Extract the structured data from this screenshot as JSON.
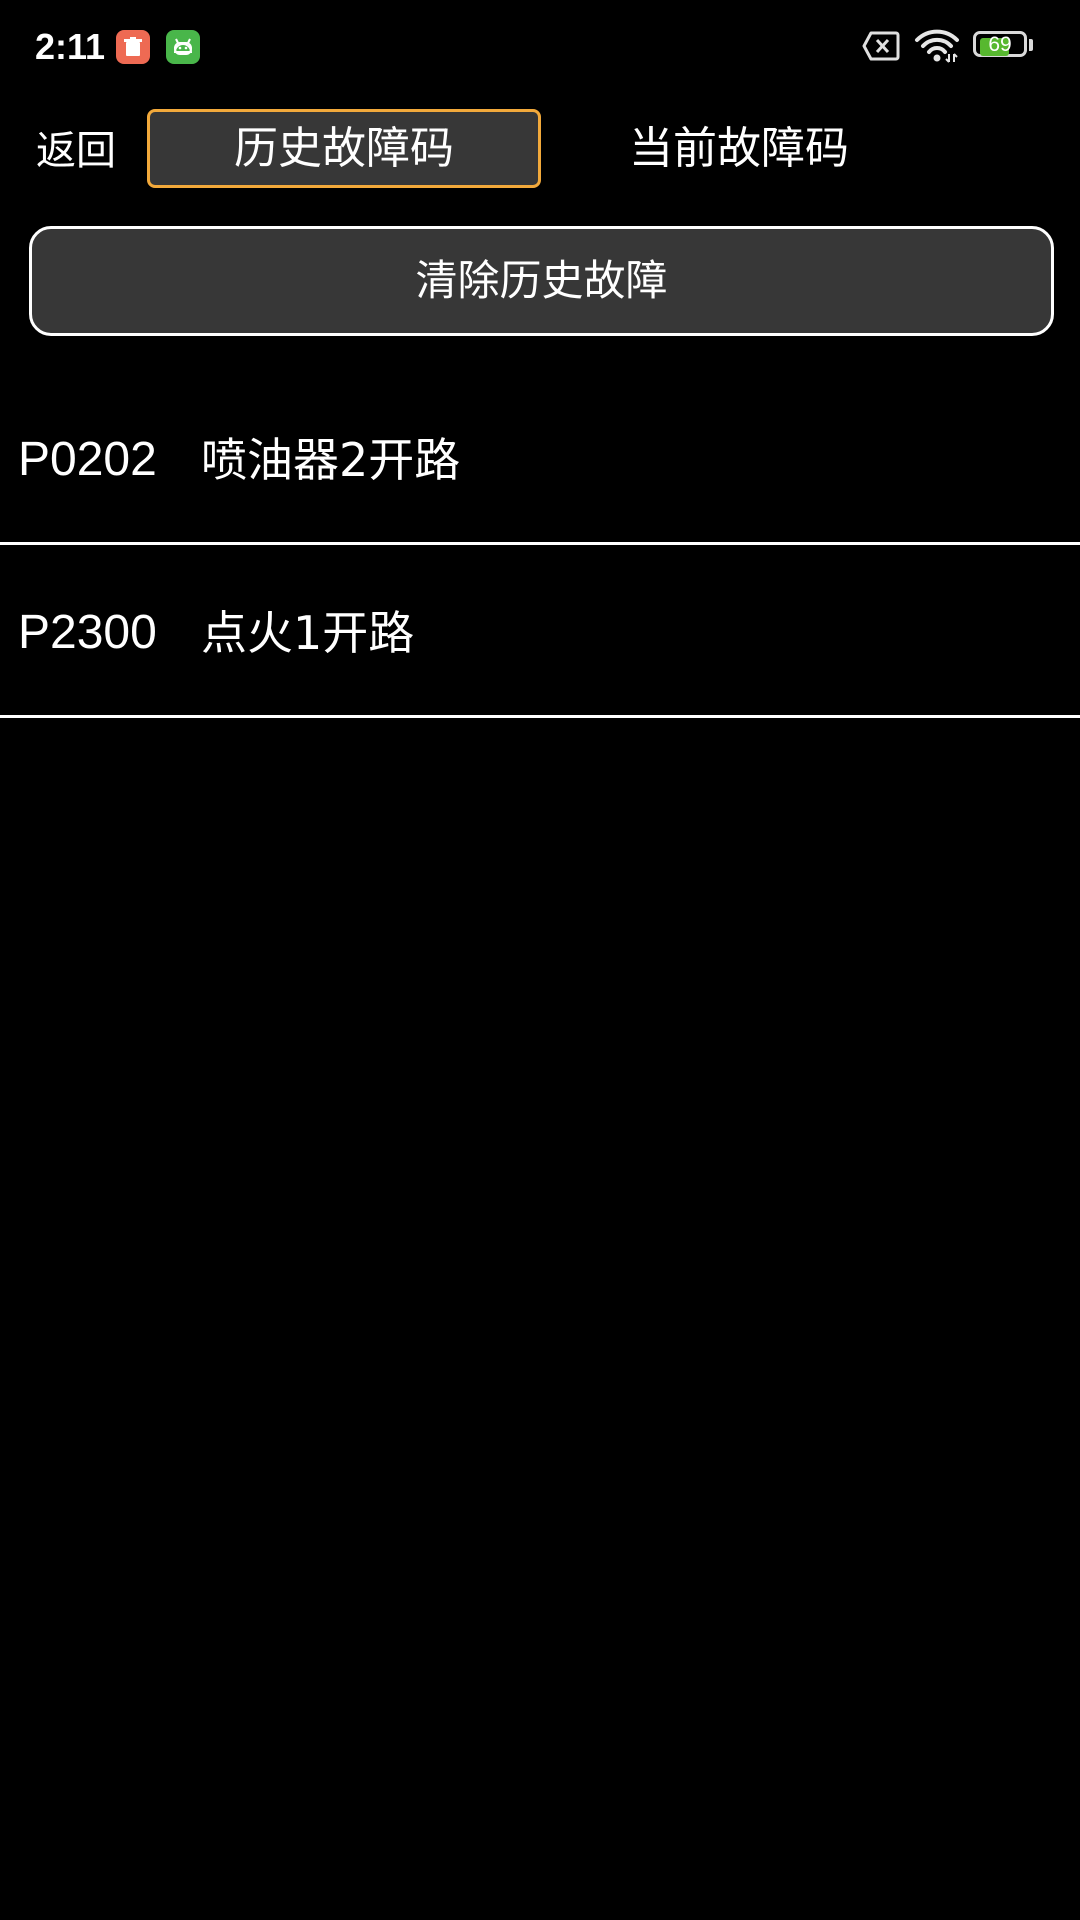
{
  "status_bar": {
    "time": "2:11",
    "battery_level": "69",
    "battery_fraction": 0.69,
    "icons": [
      "trash-app-icon",
      "android-app-icon",
      "no-sim-icon",
      "wifi-icon",
      "battery-icon"
    ],
    "colors": {
      "trash_app": "#ee6a53",
      "android_app": "#49b64a",
      "battery_fill": "#57b82f"
    }
  },
  "nav": {
    "back_label": "返回",
    "tabs": [
      {
        "label": "历史故障码",
        "selected": true
      },
      {
        "label": "当前故障码",
        "selected": false
      }
    ],
    "selected_border_color": "#f2a93b"
  },
  "actions": {
    "clear_label": "清除历史故障"
  },
  "faults": [
    {
      "code": "P0202",
      "description": "喷油器2开路"
    },
    {
      "code": "P2300",
      "description": "点火1开路"
    }
  ]
}
